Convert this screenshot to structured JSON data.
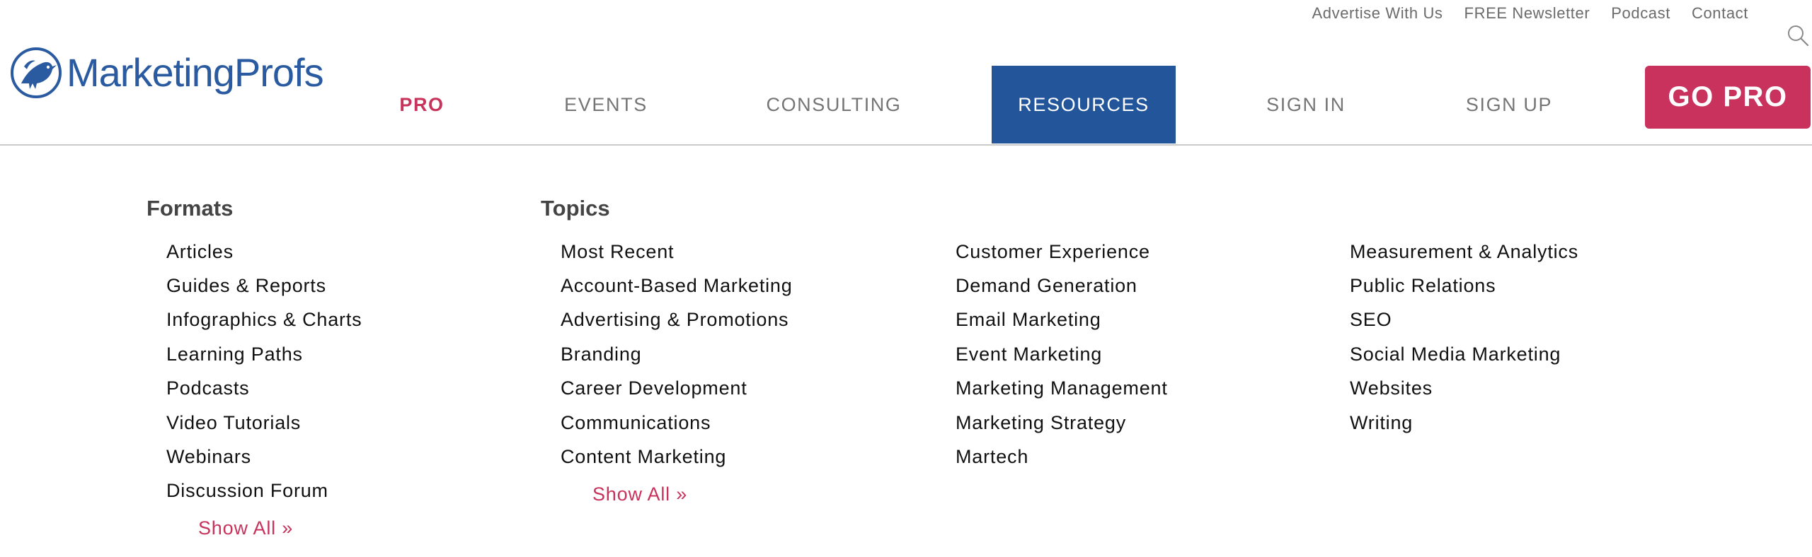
{
  "utility_nav": [
    "Advertise With Us",
    "FREE Newsletter",
    "Podcast",
    "Contact"
  ],
  "brand": {
    "name": "MarketingProfs",
    "primary_color": "#23559b",
    "accent_color": "#c8325c"
  },
  "main_nav": {
    "pro": "PRO",
    "events": "EVENTS",
    "consulting": "CONSULTING",
    "resources": "RESOURCES",
    "sign_in": "SIGN IN",
    "sign_up": "SIGN UP",
    "go_pro": "GO PRO",
    "active": "RESOURCES"
  },
  "icons": {
    "search": "search-icon",
    "logo": "bird-logo-icon"
  },
  "mega_menu": {
    "formats": {
      "heading": "Formats",
      "items": [
        "Articles",
        "Guides & Reports",
        "Infographics & Charts",
        "Learning Paths",
        "Podcasts",
        "Video Tutorials",
        "Webinars",
        "Discussion Forum"
      ],
      "show_all": "Show All »"
    },
    "topics": {
      "heading": "Topics",
      "col1": [
        "Most Recent",
        "Account-Based Marketing",
        "Advertising & Promotions",
        "Branding",
        "Career Development",
        "Communications",
        "Content Marketing"
      ],
      "col2": [
        "Customer Experience",
        "Demand Generation",
        "Email Marketing",
        "Event Marketing",
        "Marketing Management",
        "Marketing Strategy",
        "Martech"
      ],
      "col3": [
        "Measurement & Analytics",
        "Public Relations",
        "SEO",
        "Social Media Marketing",
        "Websites",
        "Writing"
      ],
      "show_all": "Show All »"
    }
  }
}
